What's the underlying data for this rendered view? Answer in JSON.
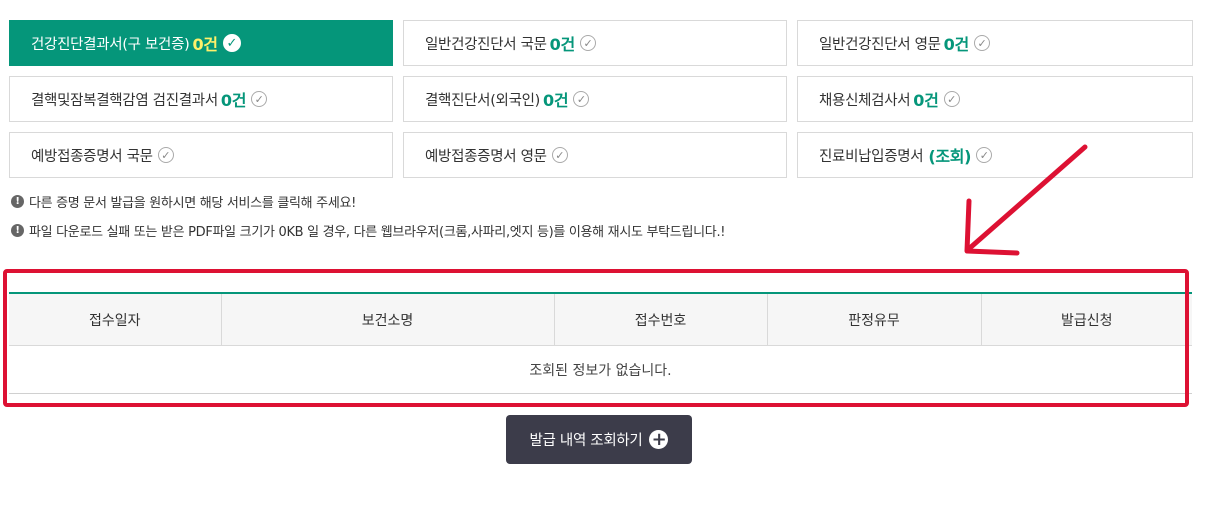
{
  "cards": [
    {
      "label": "건강진단결과서(구 보건증)",
      "count": "0건"
    },
    {
      "label": "일반건강진단서 국문",
      "count": "0건"
    },
    {
      "label": "일반건강진단서 영문",
      "count": "0건"
    },
    {
      "label": "결핵및잠복결핵감염 검진결과서",
      "count": "0건"
    },
    {
      "label": "결핵진단서(외국인)",
      "count": "0건"
    },
    {
      "label": "채용신체검사서",
      "count": "0건"
    },
    {
      "label": "예방접종증명서 국문"
    },
    {
      "label": "예방접종증명서 영문"
    },
    {
      "label": "진료비납입증명서",
      "extra": "(조회)"
    }
  ],
  "icons": {
    "check": "check-circle-icon",
    "notice": "exclamation-circle-icon",
    "add": "plus-circle-icon"
  },
  "notices": [
    "다른 증명 문서 발급을 원하시면 해당 서비스를 클릭해 주세요!",
    "파일 다운로드 실패 또는 받은 PDF파일 크기가 0KB 일 경우, 다른 웹브라우저(크롬,사파리,엣지 등)를 이용해 재시도 부탁드립니다.!"
  ],
  "table": {
    "headers": [
      "접수일자",
      "보건소명",
      "접수번호",
      "판정유무",
      "발급신청"
    ],
    "empty_message": "조회된 정보가 없습니다."
  },
  "query_button": {
    "label": "발급 내역 조회하기"
  },
  "colors": {
    "accent": "#05967a",
    "active_count": "#fff16a",
    "annotation": "#dd1133",
    "button": "#3c3c4a"
  }
}
